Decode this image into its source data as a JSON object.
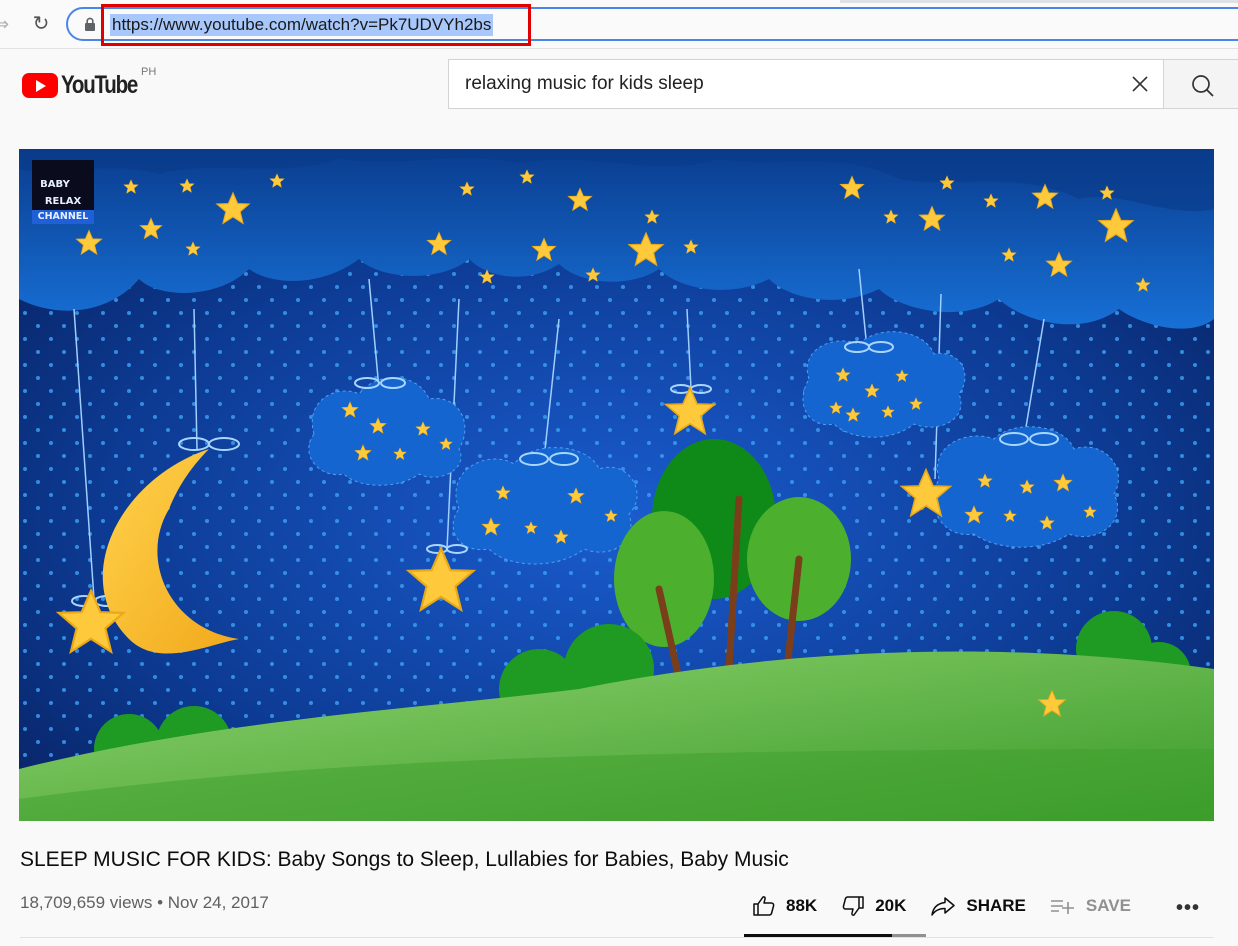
{
  "browser": {
    "url": "https://www.youtube.com/watch?v=Pk7UDVYh2bs"
  },
  "header": {
    "logo_text": "YouTube",
    "country_code": "PH",
    "search": {
      "value": "relaxing music for kids sleep",
      "clear_icon": "close-icon",
      "search_icon": "search-icon"
    }
  },
  "video": {
    "channel_badge": [
      "BABY",
      "RELAX",
      "CHANNEL"
    ],
    "title": "SLEEP MUSIC FOR KIDS: Baby Songs to Sleep, Lullabies for Babies, Baby Music",
    "views": "18,709,659 views",
    "separator": "•",
    "date": "Nov 24, 2017",
    "full_meta": "18,709,659 views • Nov 24, 2017"
  },
  "actions": {
    "like_count": "88K",
    "dislike_count": "20K",
    "share_label": "SHARE",
    "save_label": "SAVE",
    "more_label": "•••",
    "like_ratio": 0.815
  },
  "colors": {
    "brand": "#ff0000",
    "url_highlight": "#a8c7fa",
    "annotation_box": "#e00000"
  }
}
